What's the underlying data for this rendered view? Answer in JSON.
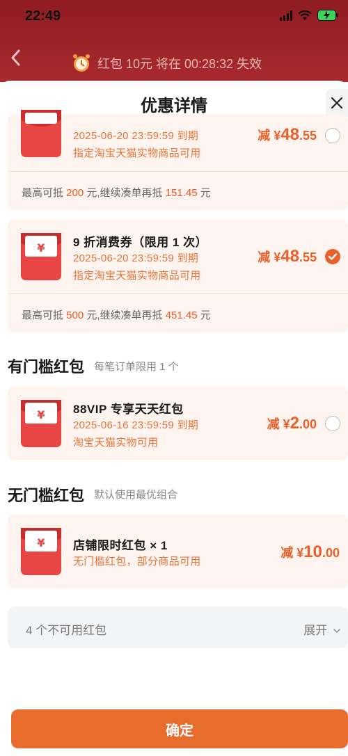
{
  "status_bar": {
    "time": "22:49"
  },
  "header": {
    "timer_text": "红包 10元 将在 00:28:32 失效"
  },
  "sheet": {
    "title": "优惠详情"
  },
  "coupons_top": [
    {
      "title": "",
      "expiry": "2025-06-20 23:59:59 到期",
      "scope": "指定淘宝天猫实物商品可用",
      "amount_prefix": "减 ¥",
      "amount_int": "48",
      "amount_dec": ".55",
      "selected": false,
      "footer_a": "最高可抵 ",
      "footer_b": "200",
      "footer_c": " 元,继续凑单再抵 ",
      "footer_d": "151.45",
      "footer_e": " 元"
    },
    {
      "title": "9 折消费券（限用 1 次）",
      "expiry": "2025-06-20 23:59:59 到期",
      "scope": "指定淘宝天猫实物商品可用",
      "amount_prefix": "减 ¥",
      "amount_int": "48",
      "amount_dec": ".55",
      "selected": true,
      "footer_a": "最高可抵 ",
      "footer_b": "500",
      "footer_c": " 元,继续凑单再抵 ",
      "footer_d": "451.45",
      "footer_e": " 元"
    }
  ],
  "threshold_section": {
    "title": "有门槛红包",
    "subtitle": "每笔订单限用 1 个",
    "item": {
      "title": "88VIP 专享天天红包",
      "expiry": "2025-06-16 23:59:59 到期",
      "scope": "淘宝天猫实物可用",
      "amount_prefix": "减 ¥",
      "amount_int": "2",
      "amount_dec": ".00",
      "selected": false
    }
  },
  "no_threshold_section": {
    "title": "无门槛红包",
    "subtitle": "默认使用最优组合",
    "item": {
      "title": "店铺限时红包 × 1",
      "scope": "无门槛红包，部分商品可用",
      "amount_prefix": "减 ¥",
      "amount_int": "10",
      "amount_dec": ".00"
    }
  },
  "unavailable": {
    "label": "4 个不可用红包",
    "expand": "展开"
  },
  "confirm_label": "确定",
  "colors": {
    "accent": "#e8612a",
    "header_bg": "#a82a2e",
    "envelope": "#e84545"
  }
}
